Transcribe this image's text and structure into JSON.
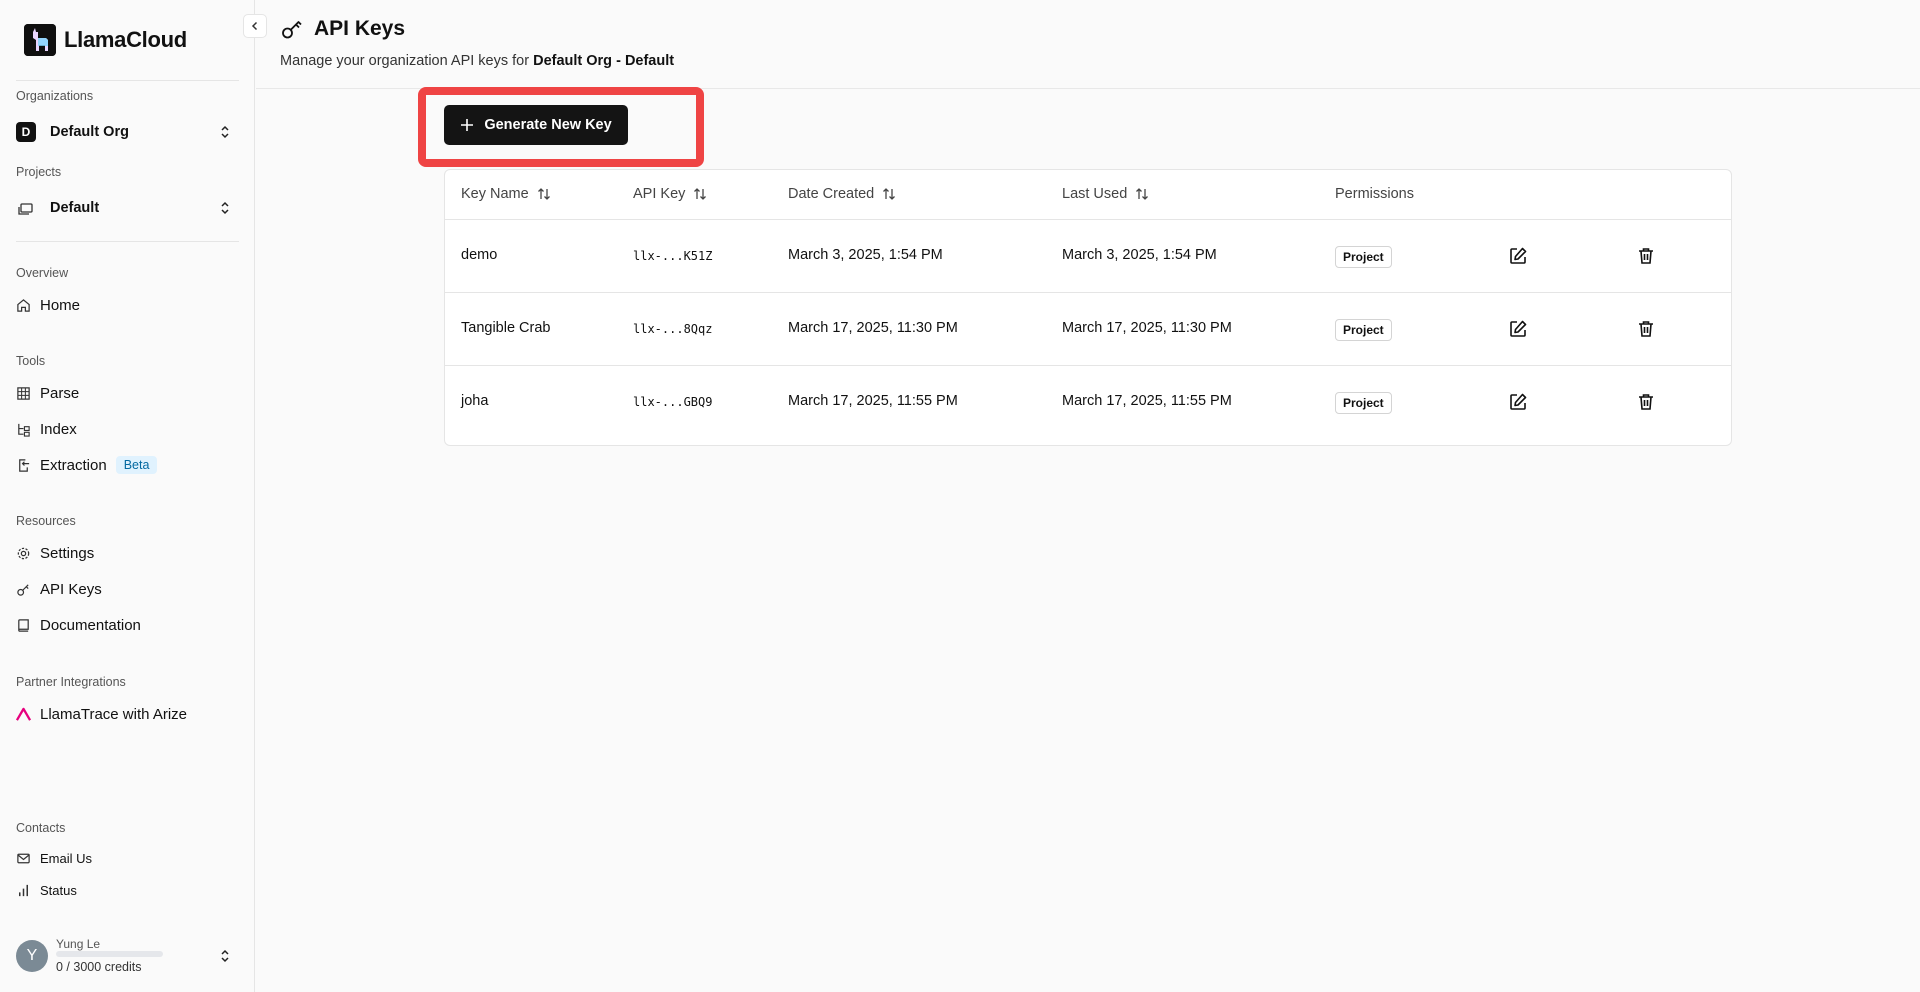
{
  "app": {
    "name": "LlamaCloud"
  },
  "sidebar": {
    "organizations_label": "Organizations",
    "org": {
      "badge": "D",
      "name": "Default Org"
    },
    "projects_label": "Projects",
    "project": {
      "name": "Default"
    },
    "overview_label": "Overview",
    "home": "Home",
    "tools_label": "Tools",
    "tools": {
      "parse": "Parse",
      "index": "Index",
      "extraction": "Extraction",
      "extraction_badge": "Beta"
    },
    "resources_label": "Resources",
    "resources": {
      "settings": "Settings",
      "api_keys": "API Keys",
      "documentation": "Documentation"
    },
    "partner_label": "Partner Integrations",
    "partner": {
      "llamatrace": "LlamaTrace with Arize"
    },
    "contacts_label": "Contacts",
    "contacts": {
      "email": "Email Us",
      "status": "Status"
    },
    "user": {
      "initial": "Y",
      "name": "Yung Le",
      "credits": "0 / 3000 credits",
      "credits_used_fraction": 0
    }
  },
  "header": {
    "title": "API Keys",
    "subtitle_prefix": "Manage your organization API keys for ",
    "subtitle_org": "Default Org",
    "subtitle_sep": " - ",
    "subtitle_project": "Default"
  },
  "generate_button": "Generate New Key",
  "table": {
    "columns": {
      "key_name": "Key Name",
      "api_key": "API Key",
      "date_created": "Date Created",
      "last_used": "Last Used",
      "permissions": "Permissions"
    },
    "rows": [
      {
        "name": "demo",
        "key": "llx-...K51Z",
        "created": "March 3, 2025, 1:54 PM",
        "last_used": "March 3, 2025, 1:54 PM",
        "permission": "Project"
      },
      {
        "name": "Tangible Crab",
        "key": "llx-...8Qqz",
        "created": "March 17, 2025, 11:30 PM",
        "last_used": "March 17, 2025, 11:30 PM",
        "permission": "Project"
      },
      {
        "name": "joha",
        "key": "llx-...GBQ9",
        "created": "March 17, 2025, 11:55 PM",
        "last_used": "March 17, 2025, 11:55 PM",
        "permission": "Project"
      }
    ]
  },
  "colors": {
    "highlight": "#ef4444",
    "primary_button": "#141414",
    "beta_bg": "#e0f2fe",
    "beta_text": "#0369a1",
    "arize_pink": "#e6007e"
  }
}
